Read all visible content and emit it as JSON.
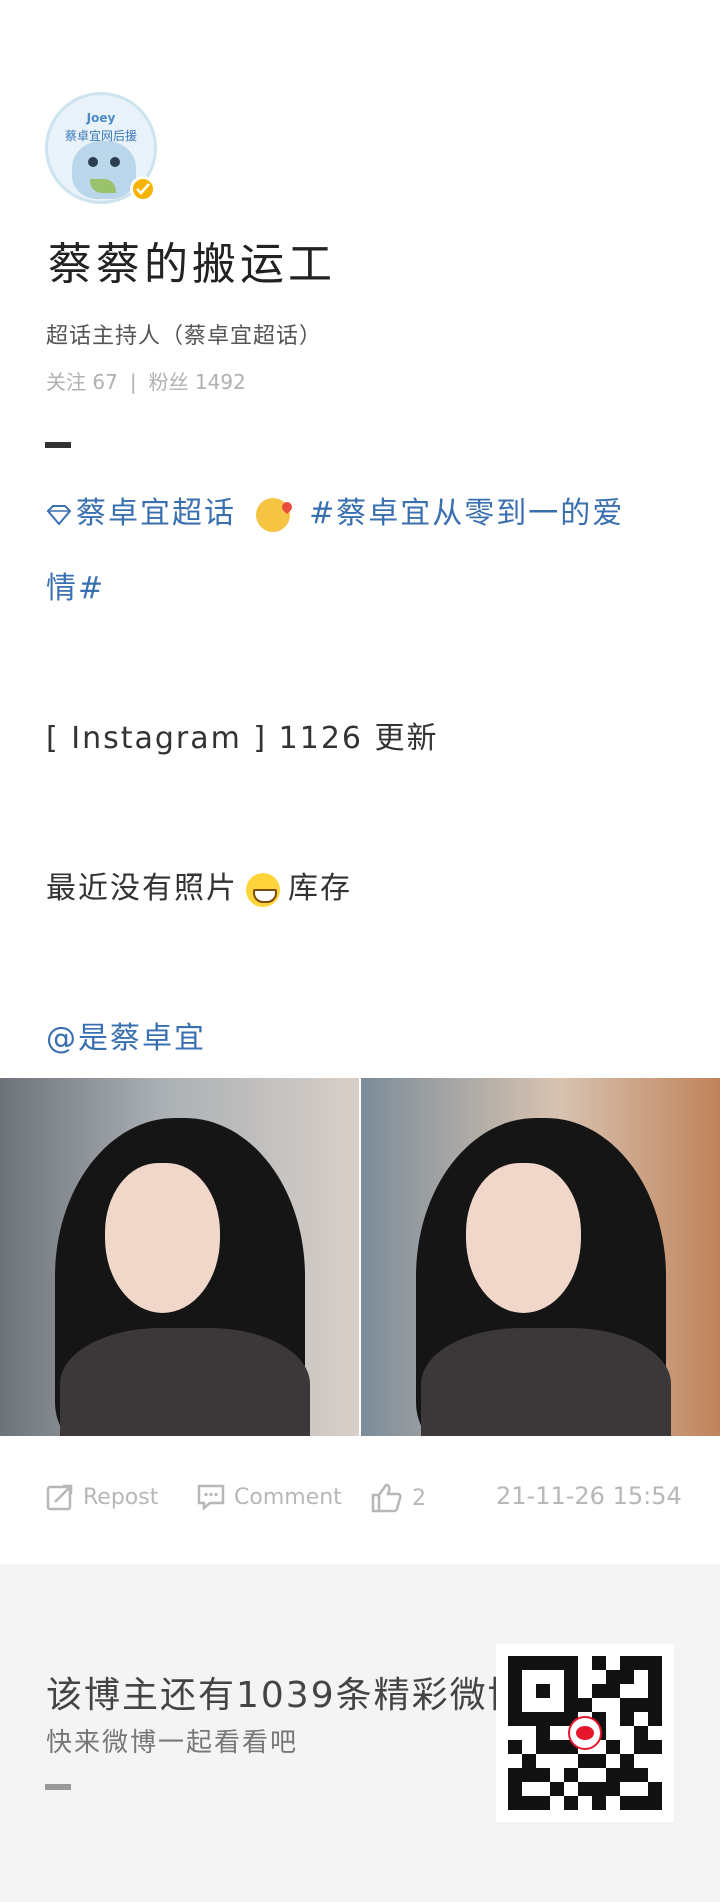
{
  "profile": {
    "avatar_lines": [
      "Joey",
      "蔡卓宜网后援"
    ],
    "username": "蔡蔡的搬运工",
    "subtitle": "超话主持人（蔡卓宜超话）",
    "following_label": "关注 67",
    "followers_label": "粉丝 1492"
  },
  "post": {
    "supertopic_link": "蔡卓宜超话",
    "hashtag_part1": "#蔡卓宜从零到一的爱",
    "hashtag_part2": "情#",
    "line_instagram": "[ Instagram ] 1126 更新",
    "line_recent_a": "最近没有照片",
    "line_recent_b": "库存",
    "mention": "@是蔡卓宜",
    "emojis": [
      "kiss-emoji",
      "grin-emoji"
    ]
  },
  "actions": {
    "repost_label": "Repost",
    "comment_label": "Comment",
    "like_count": "2",
    "timestamp": "21-11-26 15:54"
  },
  "footer": {
    "title": "该博主还有1039条精彩微博",
    "subtitle": "快来微博一起看看吧"
  },
  "colors": {
    "link": "#3a6fb0",
    "muted": "#b7b7b7",
    "verified": "#f4b400",
    "weibo_red": "#e6162d"
  }
}
